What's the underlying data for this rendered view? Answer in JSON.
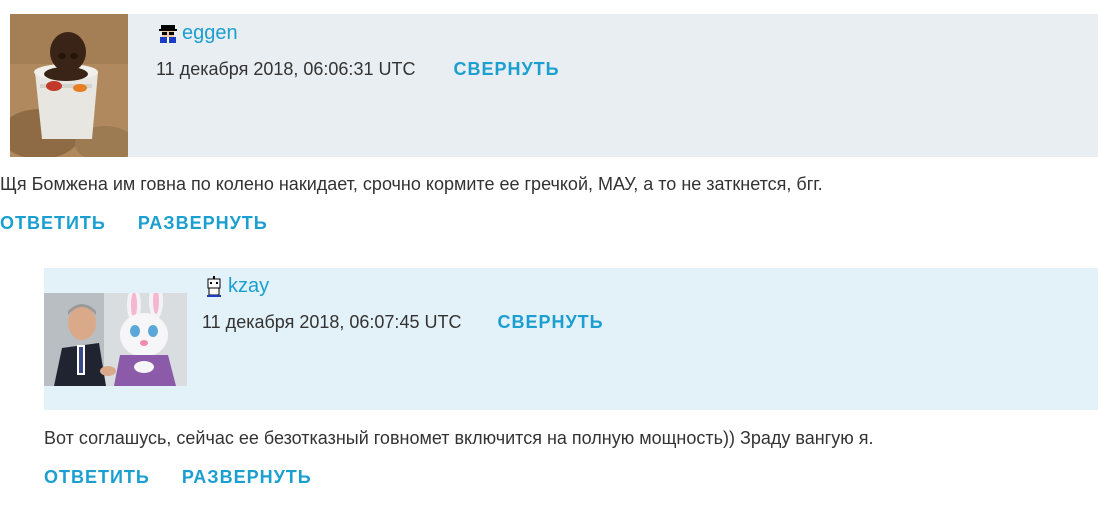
{
  "comments": [
    {
      "username": "eggen",
      "timestamp": "11 декабря 2018, 06:06:31 UTC",
      "collapse_label": "СВЕРНУТЬ",
      "text": "Щя Бомжена им говна по колено накидает, срочно кормите ее гречкой, МАУ, а то не заткнется, бгг.",
      "reply_label": "ОТВЕТИТЬ",
      "expand_label": "РАЗВЕРНУТЬ",
      "user_icon": "spy-user-icon",
      "avatar": "child-in-bucket-photo"
    },
    {
      "username": "kzay",
      "timestamp": "11 декабря 2018, 06:07:45 UTC",
      "collapse_label": "СВЕРНУТЬ",
      "text": "Вот соглашусь, сейчас ее безотказный говномет включится на полную мощность)) Зраду вангую я.",
      "reply_label": "ОТВЕТИТЬ",
      "expand_label": "РАЗВЕРНУТЬ",
      "user_icon": "robot-user-icon",
      "avatar": "man-with-bunny-costume-photo"
    }
  ],
  "colors": {
    "link": "#1a9fd0",
    "header_bg_1": "#e9eef2",
    "header_bg_2": "#e3f1f8",
    "text": "#333333"
  }
}
